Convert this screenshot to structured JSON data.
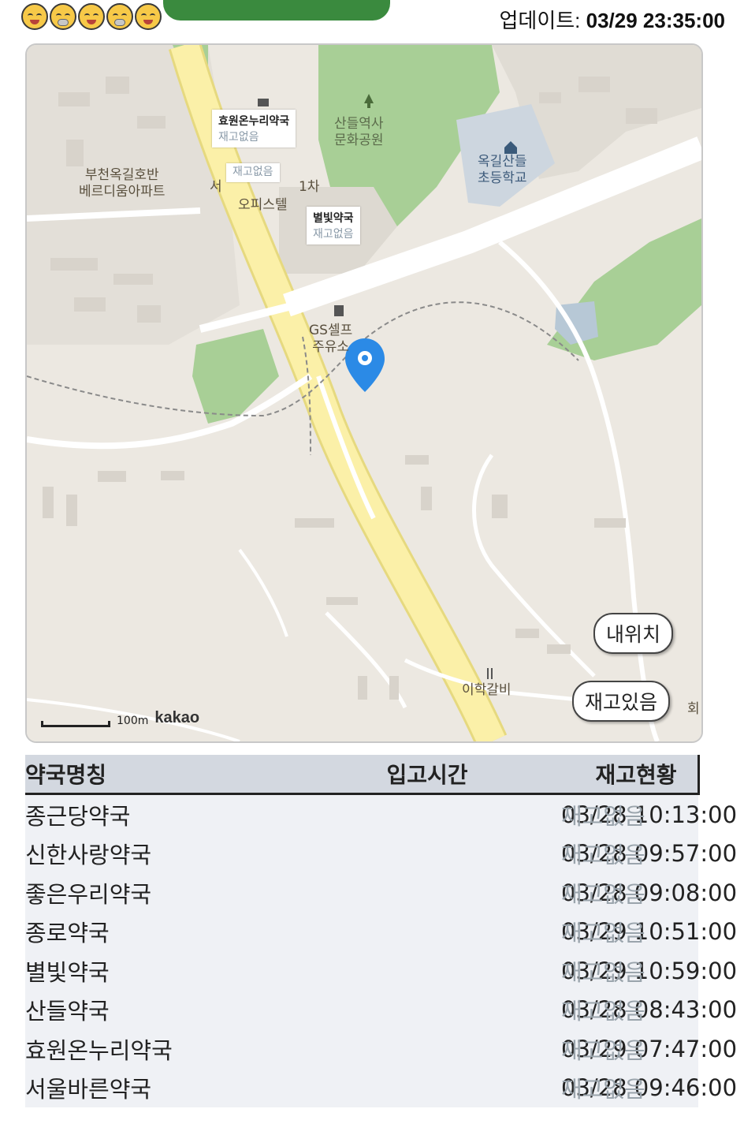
{
  "header": {
    "emojis": [
      "happy-face-icon",
      "sad-face-icon",
      "happy-face-icon",
      "sad-face-icon",
      "happy-face-icon"
    ],
    "update_label": "업데이트:",
    "update_time": "03/29 23:35:00"
  },
  "map": {
    "labels": {
      "park": "산들역사\n문화공원",
      "school": "옥길산들\n초등학교",
      "apartment": "부천옥길호반\n베르디움아파트",
      "office_prefix": "서",
      "office_suffix": "1차",
      "officetel": "오피스텔",
      "gas_station": "GS셀프\n주유소",
      "restaurant": "이학갈비",
      "edge_text": "회"
    },
    "infoboxes": [
      {
        "name": "효원온누리약국",
        "status": "재고없음"
      },
      {
        "name": "",
        "status": "재고없음"
      },
      {
        "name": "별빛약국",
        "status": "재고없음"
      }
    ],
    "buttons": {
      "my_location": "내위치",
      "in_stock": "재고있음"
    },
    "scale": "100m",
    "brand": "kakao",
    "colors": {
      "park": "#a8cf96",
      "road_main": "#fbf0a8",
      "road": "#ffffff",
      "marker": "#2b8ae6",
      "land": "#ece8e1",
      "school_area": "#cdd6df"
    }
  },
  "table": {
    "headers": [
      "약국명칭",
      "입고시간",
      "재고현황"
    ],
    "rows": [
      {
        "name": "종근당약국",
        "time": "03/28 10:13:00",
        "status": "재고없음"
      },
      {
        "name": "신한사랑약국",
        "time": "03/28 09:57:00",
        "status": "재고없음"
      },
      {
        "name": "좋은우리약국",
        "time": "03/28 09:08:00",
        "status": "재고없음"
      },
      {
        "name": "종로약국",
        "time": "03/29 10:51:00",
        "status": "재고없음"
      },
      {
        "name": "별빛약국",
        "time": "03/29 10:59:00",
        "status": "재고없음"
      },
      {
        "name": "산들약국",
        "time": "03/28 08:43:00",
        "status": "재고없음"
      },
      {
        "name": "효원온누리약국",
        "time": "03/29 07:47:00",
        "status": "재고없음"
      },
      {
        "name": "서울바른약국",
        "time": "03/28 09:46:00",
        "status": "재고없음"
      }
    ]
  }
}
